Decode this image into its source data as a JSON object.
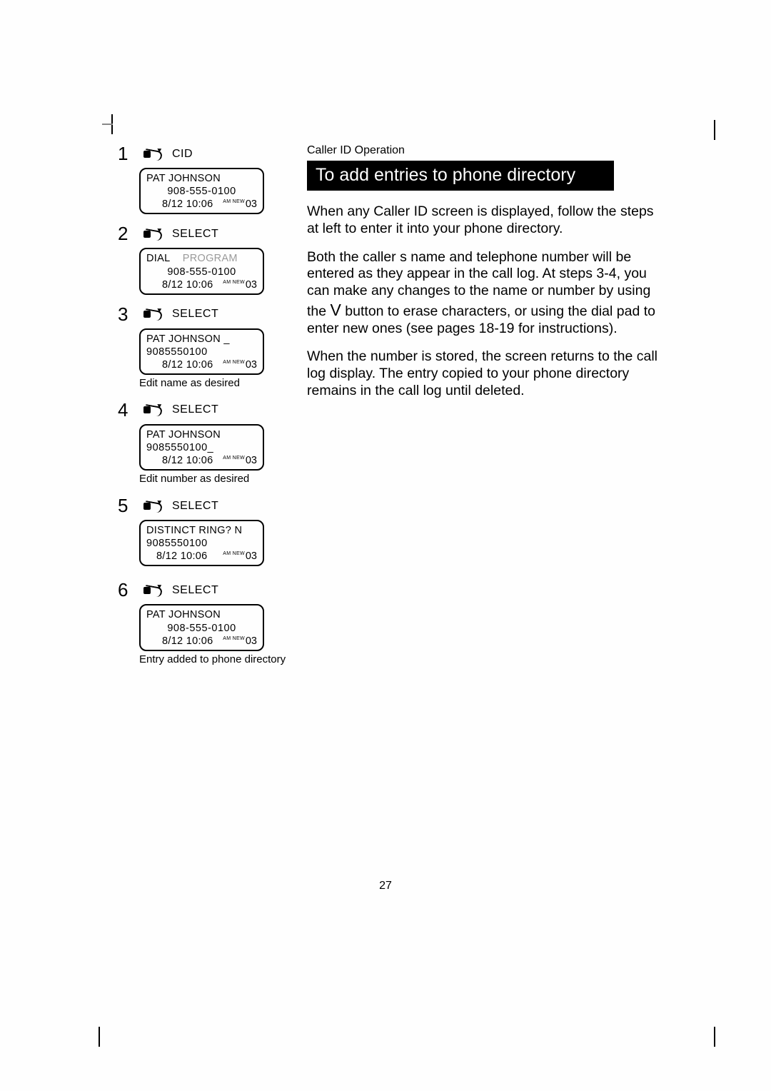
{
  "section_header": "Caller ID Operation",
  "title_bar": "To add entries to phone directory",
  "paragraphs": {
    "p1": "When any Caller ID screen is displayed, follow the steps at left to enter it into your phone directory.",
    "p2a": "Both the caller s name and telephone number will be entered as they appear in the call log. At steps 3-4, you can make any changes to the name or number by using the ",
    "p2_btn": "V",
    "p2b": " button to erase characters, or using the dial pad to enter new ones (see pages 18-19 for instructions).",
    "p3": "When the number is stored, the screen returns to the call log display. The entry copied to your phone directory remains in the call log until deleted."
  },
  "steps": [
    {
      "num": "1",
      "label": "CID",
      "lcd": {
        "l1": "PAT JOHNSON",
        "l2": "908-555-0100",
        "l2_align": "center",
        "date": "8/12 10:06",
        "amnew": "AM NEW",
        "count": "03"
      }
    },
    {
      "num": "2",
      "label": "SELECT",
      "lcd": {
        "l1a": "DIAL",
        "l1b": "PROGRAM",
        "l2": "908-555-0100",
        "l2_align": "center",
        "date": "8/12 10:06",
        "amnew": "AM NEW",
        "count": "03"
      }
    },
    {
      "num": "3",
      "label": "SELECT",
      "lcd": {
        "l1": "PAT JOHNSON    _",
        "l2": "9085550100",
        "l2_align": "left",
        "date": "8/12 10:06",
        "amnew": "AM NEW",
        "count": "03"
      },
      "caption": "Edit name as desired"
    },
    {
      "num": "4",
      "label": "SELECT",
      "lcd": {
        "l1": "PAT JOHNSON",
        "l2": "9085550100_",
        "l2_align": "left",
        "date": "8/12 10:06",
        "amnew": "AM NEW",
        "count": "03"
      },
      "caption": "Edit number as desired"
    },
    {
      "num": "5",
      "label": "SELECT",
      "lcd": {
        "l1": "DISTINCT RING? N",
        "l2": "9085550100",
        "l2_align": "left",
        "date": "8/12 10:06",
        "amnew": "AM NEW",
        "count": "03"
      }
    },
    {
      "num": "6",
      "label": "SELECT",
      "lcd": {
        "l1": "PAT JOHNSON",
        "l2": "908-555-0100",
        "l2_align": "center",
        "date": "8/12 10:06",
        "amnew": "AM NEW",
        "count": "03"
      },
      "caption": "Entry added to phone directory"
    }
  ],
  "page_number": "27"
}
